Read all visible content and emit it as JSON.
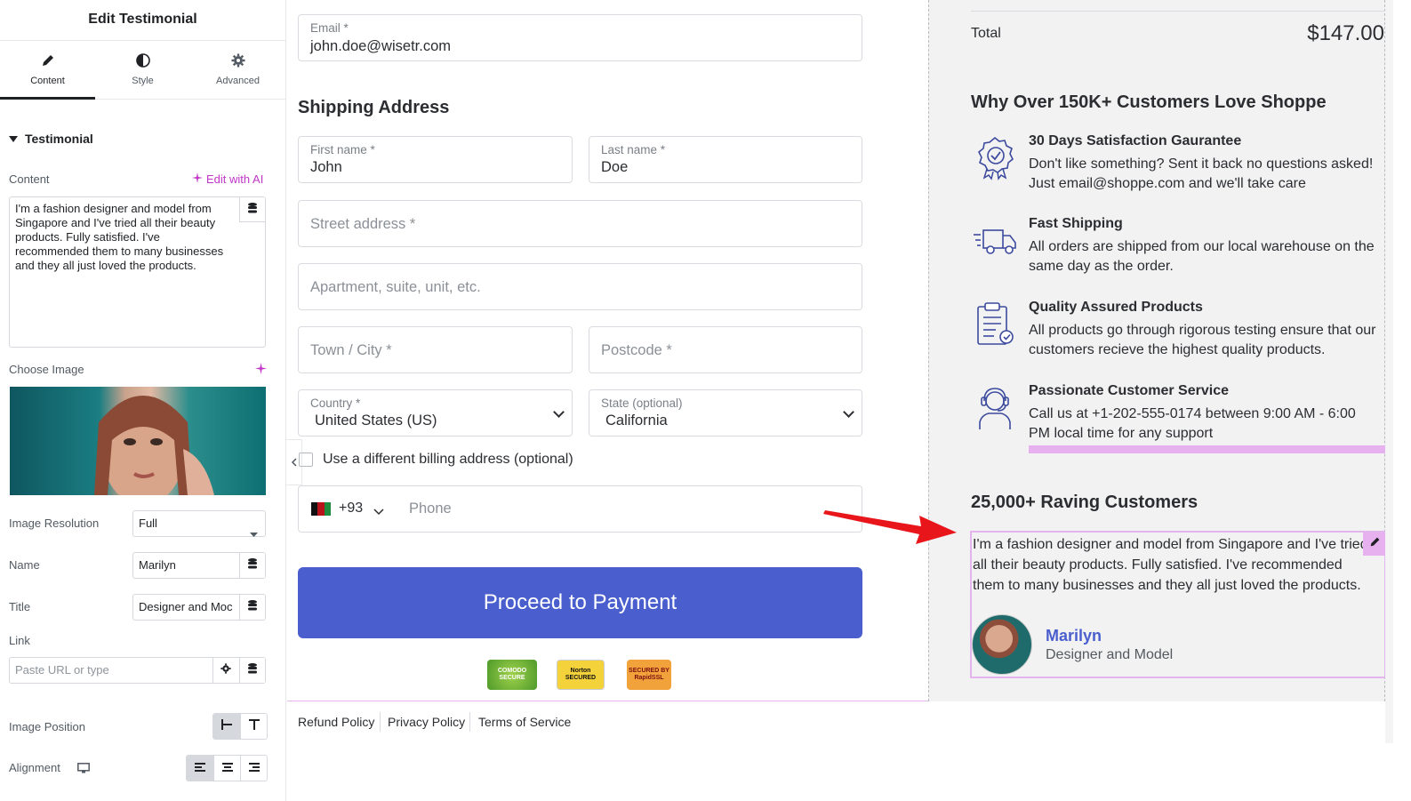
{
  "panel": {
    "title": "Edit Testimonial",
    "tabs": [
      {
        "label": "Content",
        "icon": "pencil-icon"
      },
      {
        "label": "Style",
        "icon": "half-circle-icon"
      },
      {
        "label": "Advanced",
        "icon": "gear-icon"
      }
    ],
    "section_label": "Testimonial",
    "content_label": "Content",
    "edit_ai_label": "Edit with AI",
    "content_text": "I'm a fashion designer and model from Singapore and I've tried all their beauty products. Fully satisfied. I've recommended them to many businesses and they all just loved the products.",
    "choose_image_label": "Choose Image",
    "image_resolution_label": "Image Resolution",
    "image_resolution_value": "Full",
    "name_label": "Name",
    "name_value": "Marilyn",
    "title_label": "Title",
    "title_value": "Designer and Moc",
    "link_label": "Link",
    "link_placeholder": "Paste URL or type",
    "image_position_label": "Image Position",
    "alignment_label": "Alignment"
  },
  "checkout": {
    "email_label": "Email *",
    "email_value": "john.doe@wisetr.com",
    "shipping_heading": "Shipping Address",
    "first_name_label": "First name *",
    "first_name_value": "John",
    "last_name_label": "Last name *",
    "last_name_value": "Doe",
    "street_placeholder": "Street address *",
    "apartment_placeholder": "Apartment, suite, unit, etc.",
    "city_placeholder": "Town / City *",
    "postcode_placeholder": "Postcode *",
    "country_label": "Country *",
    "country_value": "United States (US)",
    "state_label": "State (optional)",
    "state_value": "California",
    "billing_checkbox_label": "Use a different billing address (optional)",
    "phone_code": "+93",
    "phone_placeholder": "Phone",
    "pay_button": "Proceed to Payment",
    "badges": [
      "COMODO SECURE",
      "Norton SECURED",
      "SECURED BY RapidSSL"
    ],
    "footer_links": [
      "Refund Policy",
      "Privacy Policy",
      "Terms of Service"
    ]
  },
  "summary": {
    "total_label": "Total",
    "total_value": "$147.00",
    "why_heading": "Why Over 150K+ Customers Love Shoppe",
    "features": [
      {
        "title": "30 Days Satisfaction Gaurantee",
        "desc": "Don't like something? Sent it back no questions asked! Just email@shoppe.com and we'll take care",
        "icon": "badge-icon"
      },
      {
        "title": "Fast Shipping",
        "desc": "All orders are shipped from our local warehouse on the same day as the order.",
        "icon": "truck-icon"
      },
      {
        "title": "Quality Assured Products",
        "desc": "All products go through rigorous testing ensure that our customers recieve the highest quality products.",
        "icon": "clipboard-check-icon"
      },
      {
        "title": "Passionate Customer Service",
        "desc": "Call us at +1-202-555-0174 between 9:00 AM - 6:00 PM local time for any support",
        "icon": "headset-icon"
      }
    ],
    "raving_heading": "25,000+ Raving Customers",
    "testimonial_text": "I'm a fashion designer and model from Singapore and I've tried all their beauty products. Fully satisfied. I've recommended them to many businesses and they all just loved the products.",
    "testimonial_name": "Marilyn",
    "testimonial_title": "Designer and Model"
  },
  "colors": {
    "accent": "#4a5fcd",
    "ai_pink": "#c036c6",
    "highlight": "#e7b0ee",
    "arrow": "#e8161b"
  }
}
